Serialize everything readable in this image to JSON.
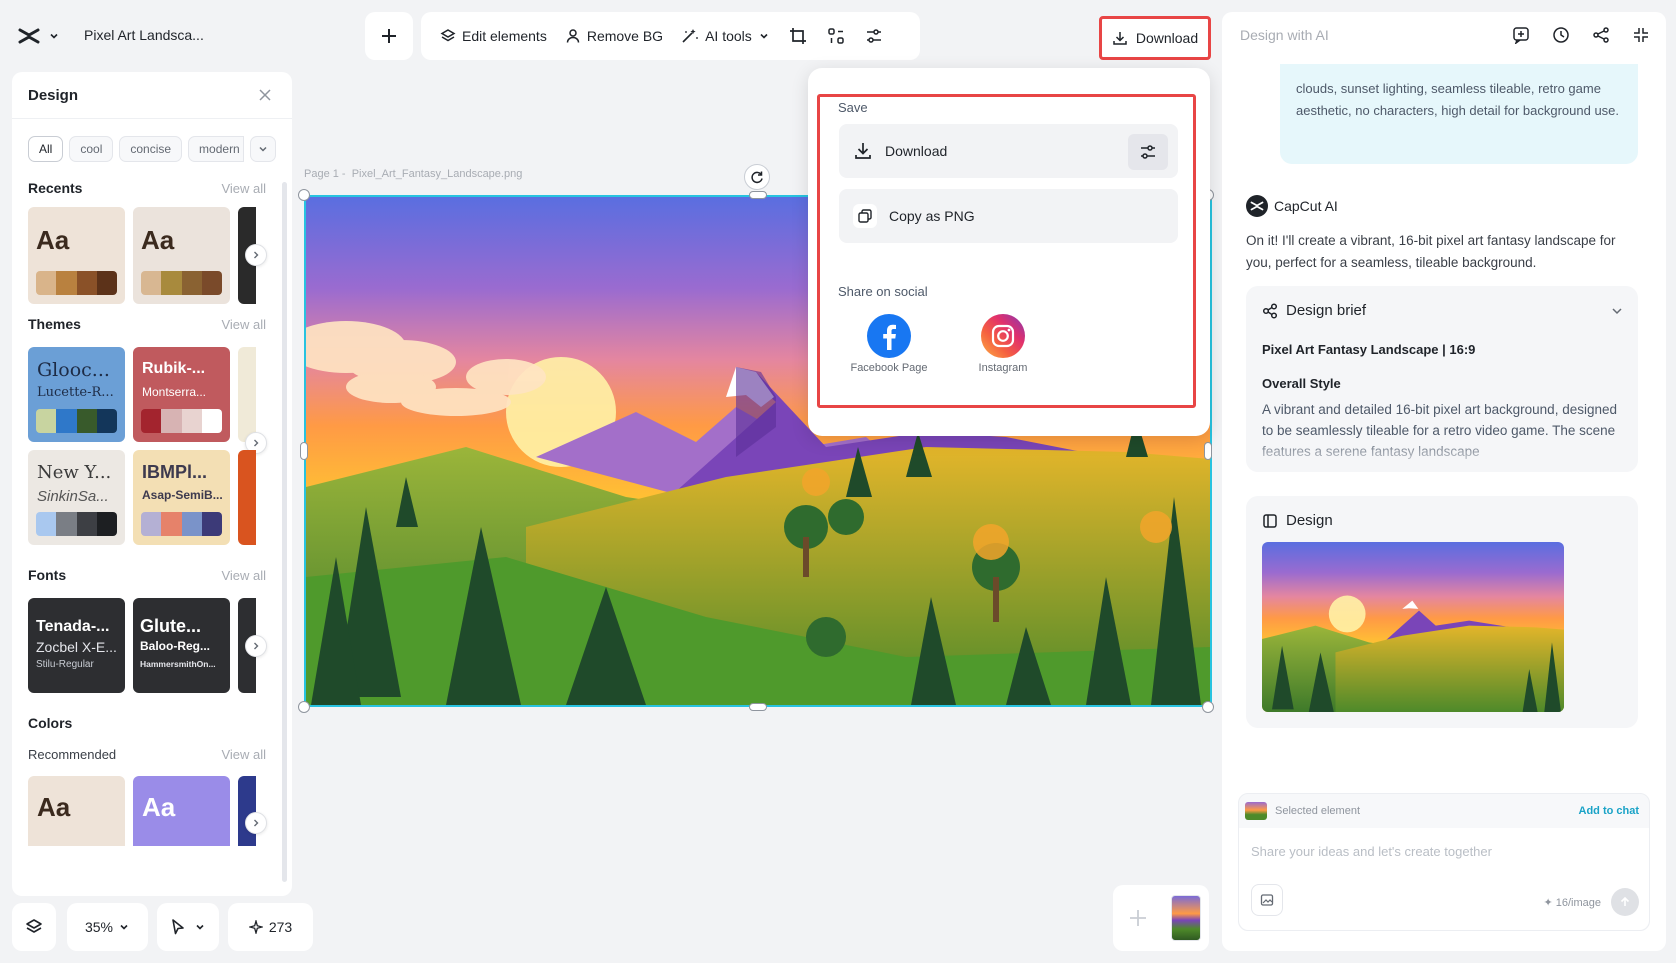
{
  "header": {
    "project_title": "Pixel Art Landsca...",
    "logo_icon": "capcut-logo-icon"
  },
  "toolbar": {
    "add_icon": "plus-icon",
    "edit_elements": "Edit elements",
    "remove_bg": "Remove BG",
    "ai_tools": "AI tools",
    "download_label": "Download"
  },
  "design_panel": {
    "title": "Design",
    "tags": [
      "All",
      "cool",
      "concise",
      "modern"
    ],
    "recents": {
      "heading": "Recents",
      "view_all": "View all",
      "cards": [
        {
          "text": "Aa",
          "bg": "#eee3d8",
          "colors": [
            "#d9b48a",
            "#b9813f",
            "#8a5128",
            "#5c3219"
          ]
        },
        {
          "text": "Aa",
          "bg": "#ebe3dc",
          "colors": [
            "#d8b792",
            "#a88a3d",
            "#8a6232",
            "#7a4a2a"
          ]
        }
      ]
    },
    "themes": {
      "heading": "Themes",
      "view_all": "View all",
      "cards": [
        {
          "title": "Glooc...",
          "subtitle": "Lucette-R...",
          "bg": "#6b9fd6",
          "fg": "#1d2b45",
          "colors": [
            "#c8d4a0",
            "#2f78c9",
            "#385a2b",
            "#13365a"
          ]
        },
        {
          "title": "Rubik-...",
          "subtitle": "Montserra...",
          "bg": "#c05a5e",
          "fg": "#ffffff",
          "colors": [
            "#a3242e",
            "#d7b3b3",
            "#e8d3d0",
            "#ffffff"
          ]
        },
        {
          "title": "New Y...",
          "subtitle": "SinkinSa...",
          "bg": "#ece8e3",
          "fg": "#3b3b3b",
          "colors": [
            "#a9c8ef",
            "#7a7e85",
            "#3d3f44",
            "#1d1f22"
          ]
        },
        {
          "title": "IBMPl...",
          "subtitle": "Asap-SemiB...",
          "bg": "#f3dfb4",
          "fg": "#3d3a4e",
          "colors": [
            "#b4b0d4",
            "#e6826a",
            "#7a93c9",
            "#3c3a78"
          ]
        }
      ]
    },
    "fonts": {
      "heading": "Fonts",
      "view_all": "View all",
      "cards": [
        {
          "line1": "Tenada-...",
          "line2": "Zocbel X-E...",
          "line3": "Stilu-Regular"
        },
        {
          "line1": "Glute...",
          "line2": "Baloo-Reg...",
          "line3": "HammersmithOn..."
        }
      ]
    },
    "colors": {
      "heading": "Colors",
      "sub": "Recommended",
      "view_all": "View all",
      "cards": [
        {
          "text": "Aa",
          "bg": "#eee3d8",
          "fg": "#3b2a1e"
        },
        {
          "text": "Aa",
          "bg": "#9a8ce8",
          "fg": "#ffffff"
        }
      ]
    }
  },
  "canvas": {
    "page_label": "Page 1 -",
    "file_name": "Pixel_Art_Fantasy_Landscape.png"
  },
  "download_menu": {
    "save_heading": "Save",
    "download": "Download",
    "copy_png": "Copy as PNG",
    "share_heading": "Share on social",
    "social": [
      {
        "label": "Facebook Page",
        "icon": "facebook-icon"
      },
      {
        "label": "Instagram",
        "icon": "instagram-icon"
      }
    ]
  },
  "bottom_left": {
    "zoom": "35%",
    "credits": "273"
  },
  "ai_panel": {
    "title": "Design with AI",
    "user_message": "clouds, sunset lighting, seamless tileable, retro game aesthetic, no characters, high detail for background use.",
    "assistant_name": "CapCut AI",
    "assistant_message": "On it! I'll create a vibrant, 16-bit pixel art fantasy landscape for you, perfect for a seamless, tileable background.",
    "brief": {
      "heading": "Design brief",
      "project": "Pixel Art Fantasy Landscape | 16:9",
      "style_heading": "Overall Style",
      "style_text": "A vibrant and detailed 16-bit pixel art background, designed to be seamlessly tileable for a retro video game. The scene features a serene fantasy landscape"
    },
    "design_heading": "Design",
    "selected_label": "Selected element",
    "add_to_chat": "Add to chat",
    "input_placeholder": "Share your ideas and let's create together",
    "cost": "✦ 16/image"
  },
  "accent": "#28c3e0",
  "highlight": "#e84545"
}
